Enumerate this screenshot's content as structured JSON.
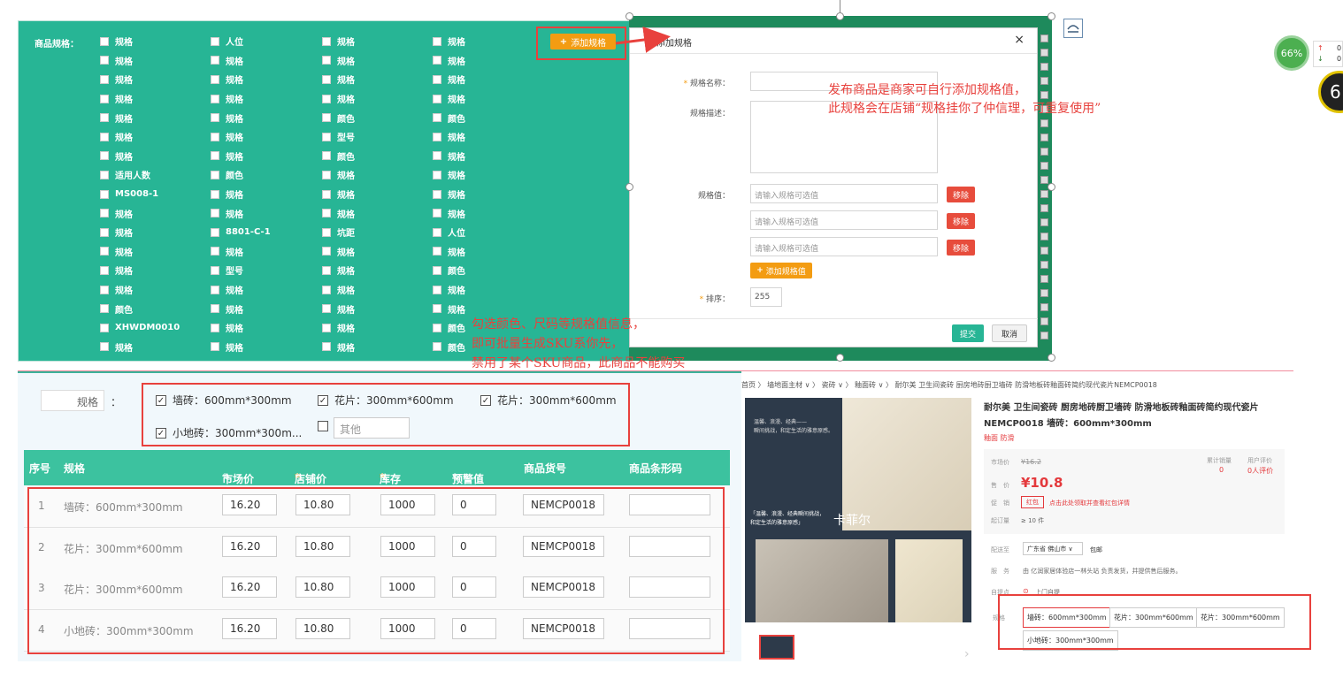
{
  "spec_panel": {
    "label": "商品规格：",
    "add_button": "添加规格",
    "columns": [
      [
        "规格",
        "规格",
        "规格",
        "规格",
        "规格",
        "规格",
        "规格",
        "适用人数",
        "MS008-1",
        "规格",
        "规格",
        "规格",
        "规格",
        "规格",
        "颜色",
        "XHWDM0010",
        "规格"
      ],
      [
        "人位",
        "规格",
        "规格",
        "规格",
        "规格",
        "规格",
        "规格",
        "颜色",
        "规格",
        "规格",
        "8801-C-1",
        "规格",
        "型号",
        "规格",
        "规格",
        "规格",
        "规格"
      ],
      [
        "规格",
        "规格",
        "规格",
        "规格",
        "颜色",
        "型号",
        "颜色",
        "规格",
        "规格",
        "规格",
        "坑距",
        "规格",
        "规格",
        "规格",
        "规格",
        "规格",
        "规格"
      ],
      [
        "规格",
        "规格",
        "规格",
        "规格",
        "颜色",
        "规格",
        "规格",
        "规格",
        "规格",
        "规格",
        "人位",
        "规格",
        "颜色",
        "规格",
        "规格",
        "颜色",
        "颜色"
      ]
    ]
  },
  "dialog": {
    "title": "添加规格",
    "close": "×",
    "name_label": "规格名称：",
    "desc_label": "规格描述：",
    "values_label": "规格值：",
    "value_placeholder": "请输入规格可选值",
    "remove_label": "移除",
    "add_value_label": "添加规格值",
    "sort_label": "排序：",
    "sort_value": "255",
    "submit": "提交",
    "cancel": "取消",
    "required_mark": "*"
  },
  "annotations": {
    "note1_line1": "发布商品是商家可自行添加规格值，",
    "note1_line2": "此规格会在店铺“规格挂你了仲信理，可重复使用”",
    "note2_line1": "勾选颜色、尺码等规格值信息，",
    "note2_line2": "即可批量生成SKU系你先，",
    "note2_line3": "禁用了某个SKU商品，此商品不能购买"
  },
  "sku_panel": {
    "spec_label": "规格",
    "colon": "：",
    "options": [
      {
        "label": "墙砖：600mm*300mm",
        "checked": true
      },
      {
        "label": "花片：300mm*600mm",
        "checked": true
      },
      {
        "label": "花片：300mm*600mm",
        "checked": true
      },
      {
        "label": "小地砖：300mm*300m...",
        "checked": true
      },
      {
        "label": "",
        "checked": false
      }
    ],
    "other_placeholder": "其他",
    "headers": [
      "序号",
      "规格",
      "市场价",
      "店铺价",
      "库存",
      "预警值",
      "商品货号",
      "商品条形码"
    ],
    "rows": [
      {
        "no": "1",
        "spec": "墙砖：600mm*300mm",
        "market": "16.20",
        "shop": "10.80",
        "stock": "1000",
        "warn": "0",
        "sku": "NEMCP0018",
        "barcode": ""
      },
      {
        "no": "2",
        "spec": "花片：300mm*600mm",
        "market": "16.20",
        "shop": "10.80",
        "stock": "1000",
        "warn": "0",
        "sku": "NEMCP0018",
        "barcode": ""
      },
      {
        "no": "3",
        "spec": "花片：300mm*600mm",
        "market": "16.20",
        "shop": "10.80",
        "stock": "1000",
        "warn": "0",
        "sku": "NEMCP0018",
        "barcode": ""
      },
      {
        "no": "4",
        "spec": "小地砖：300mm*300mm",
        "market": "16.20",
        "shop": "10.80",
        "stock": "1000",
        "warn": "0",
        "sku": "NEMCP0018",
        "barcode": ""
      }
    ]
  },
  "product": {
    "breadcrumb": "首页 〉 墙地面主材 ∨ 〉 瓷砖 ∨ 〉 釉面砖 ∨ 〉 耐尔美 卫生间瓷砖 厨房地砖厨卫墙砖 防滑地板砖釉面砖简约现代瓷片NEMCP0018",
    "title_line1": "耐尔美 卫生间瓷砖 厨房地砖厨卫墙砖 防滑地板砖釉面砖简约现代瓷片",
    "title_line2": "NEMCP0018 墙砖：600mm*300mm",
    "tags": "釉面 防滑",
    "market_label": "市场价",
    "market_price": "¥16.2",
    "sales_label": "累计销量",
    "sales_value": "0",
    "review_label": "用户评价",
    "review_value": "0人评价",
    "price_label": "售　价",
    "price": "¥10.8",
    "promo_label": "促　销",
    "promo_badge": "红包",
    "promo_text": "点击此处领取并查看红包详情",
    "min_order_label": "起订量",
    "min_order": "≥ 10 件",
    "ship_label": "配送至",
    "ship_region": "广东省 佛山市",
    "ship_free": "包邮",
    "service_label": "服　务",
    "service_text": "由 亿润家居体验店一林头站 负责发货，并提供售后服务。",
    "pickup_label": "自提点",
    "pickup_text": "上门自提",
    "spec_label": "规格",
    "specs": [
      "墙砖：600mm*300mm",
      "花片：300mm*600mm",
      "花片：300mm*600mm",
      "小地砖：300mm*300mm"
    ],
    "image_text1": "温馨、浪漫、经典——",
    "image_text2": "瞬间挑战，和定生活的雅意原感。",
    "image_brand": "卡菲尔",
    "image_caption1": "「温馨、浪漫、经典瞬间挑战，",
    "image_caption2": "和定生活的雅意原感」"
  },
  "widget": {
    "percent": "66%",
    "up_value": "0",
    "down_value": "0",
    "big_digit": "6"
  },
  "colors": {
    "green_panel": "#27b595",
    "header_green": "#3cc29f",
    "accent_orange": "#f39c12",
    "red": "#e8413d",
    "price_red": "#e4393c"
  }
}
